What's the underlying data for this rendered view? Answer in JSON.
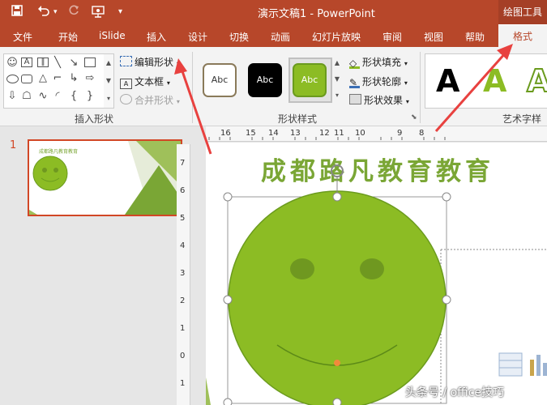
{
  "window": {
    "title": "演示文稿1  -  PowerPoint",
    "contextual_tools": "绘图工具",
    "quick_access": [
      "save-icon",
      "undo-icon",
      "redo-icon",
      "presenter-icon",
      "customize-icon"
    ]
  },
  "tabs": [
    "文件",
    "开始",
    "iSlide",
    "插入",
    "设计",
    "切换",
    "动画",
    "幻灯片放映",
    "审阅",
    "视图",
    "帮助",
    "格式"
  ],
  "active_tab": "格式",
  "ribbon": {
    "insert_shapes": {
      "label": "插入形状",
      "edit_shape": "编辑形状",
      "text_box": "文本框",
      "merge_shapes": "合并形状"
    },
    "shape_styles": {
      "label": "形状样式",
      "presets": [
        "Abc",
        "Abc",
        "Abc"
      ],
      "fill": "形状填充",
      "outline": "形状轮廓",
      "effects": "形状效果"
    },
    "wordart": {
      "label": "艺术字样式",
      "samples": [
        "A",
        "A",
        "A"
      ]
    }
  },
  "slides_pane": {
    "slide_number": "1",
    "thumb_title": "成都路凡教育教育"
  },
  "ruler": {
    "h_ticks": [
      "16",
      "15",
      "14",
      "13",
      "12",
      "11",
      "10",
      "9",
      "8"
    ],
    "v_ticks": [
      "7",
      "6",
      "5",
      "4",
      "3",
      "2",
      "1",
      "0",
      "1"
    ]
  },
  "slide": {
    "title": "成都路凡教育教育"
  },
  "colors": {
    "accent": "#b7472a",
    "shape_fill": "#8cbc24",
    "shape_outline": "#6b9b1e",
    "eyes": "#6f9820",
    "arrow": "#e8413f"
  },
  "watermark": "头条号 / office技巧"
}
